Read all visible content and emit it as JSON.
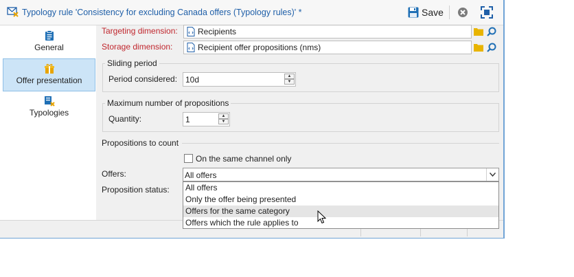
{
  "window": {
    "title": "Typology rule 'Consistency for excluding Canada offers (Typology rules)' *",
    "save_label": "Save"
  },
  "sidebar": {
    "items": [
      {
        "label": "General",
        "icon": "clipboard-icon"
      },
      {
        "label": "Offer presentation",
        "icon": "gift-icon",
        "active": true
      },
      {
        "label": "Typologies",
        "icon": "typology-icon"
      }
    ]
  },
  "form": {
    "targeting_label": "Targeting dimension:",
    "targeting_value": "Recipients",
    "storage_label": "Storage dimension:",
    "storage_value": "Recipient offer propositions (nms)",
    "sliding_period_title": "Sliding period",
    "period_label": "Period considered:",
    "period_value": "10d",
    "max_props_title": "Maximum number of propositions",
    "quantity_label": "Quantity:",
    "quantity_value": "1",
    "props_to_count_title": "Propositions to count",
    "same_channel_label": "On the same channel only",
    "offers_label": "Offers:",
    "offers_value": "All offers",
    "status_label": "Proposition status:"
  },
  "dropdown": {
    "options": [
      "All offers",
      "Only the offer being presented",
      "Offers for the same category",
      "Offers which the rule applies to"
    ],
    "hovered_index": 2
  },
  "colors": {
    "title_text": "#1f5fa8",
    "required_label": "#c0262d",
    "sidebar_active": "#cce4f7",
    "folder_icon": "#e8b400",
    "search_icon": "#1f6fb5"
  }
}
